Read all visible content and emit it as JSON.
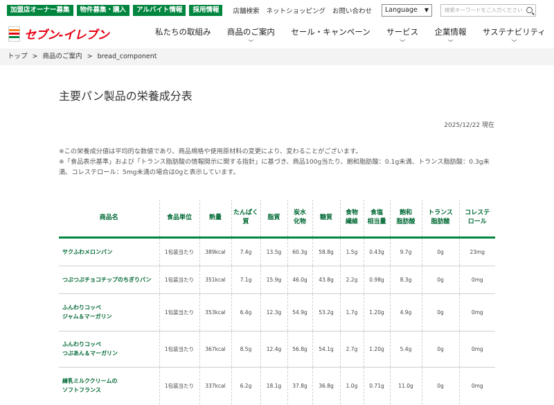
{
  "util": {
    "buttons": [
      "加盟店オーナー募集",
      "物件募集・購入",
      "アルバイト情報",
      "採用情報"
    ],
    "links": [
      "店舗検索",
      "ネットショッピング",
      "お問い合わせ"
    ],
    "language": "Language",
    "search_placeholder": "検索キーワードをご入力ください"
  },
  "logo": {
    "text": "セブン-イレブン",
    "mark": "7"
  },
  "nav": [
    {
      "label": "私たちの取組み",
      "has_sub": false
    },
    {
      "label": "商品のご案内",
      "has_sub": true
    },
    {
      "label": "セール・キャンペーン",
      "has_sub": false
    },
    {
      "label": "サービス",
      "has_sub": true
    },
    {
      "label": "企業情報",
      "has_sub": true
    },
    {
      "label": "サステナビリティ",
      "has_sub": true
    }
  ],
  "breadcrumb": [
    "トップ",
    ">",
    "商品のご案内",
    ">",
    "bread_component"
  ],
  "page": {
    "title": "主要パン製品の栄養成分表",
    "date": "2025/12/22 現在",
    "note1": "※この栄養成分値は平均的な数値であり、商品規格や使用原材料の変更により、変わることがございます。",
    "note2": "※「食品表示基準」および「トランス脂肪酸の情報開示に関する指針」に基づき、商品100g当たり、飽和脂肪酸：0.1g未満、トランス脂肪酸：0.3g未満、コレステロール：5mg未満の場合は0gと表示しています。"
  },
  "table": {
    "headers": [
      "商品名",
      "食品単位",
      "熱量",
      "たんぱく\n質",
      "脂質",
      "炭水\n化物",
      "糖質",
      "食物\n繊維",
      "食塩\n相当量",
      "飽和\n脂肪酸",
      "トランス\n脂肪酸",
      "コレステ\nロール"
    ],
    "rows": [
      [
        "サクふわメロンパン",
        "1包装当たり",
        "389kcal",
        "7.4g",
        "13.5g",
        "60.3g",
        "58.8g",
        "1.5g",
        "0.43g",
        "9.7g",
        "0g",
        "23mg"
      ],
      [
        "つぶつぶチョコチップのちぎりパン",
        "1包装当たり",
        "351kcal",
        "7.1g",
        "15.9g",
        "46.0g",
        "43.8g",
        "2.2g",
        "0.98g",
        "8.3g",
        "0g",
        "0mg"
      ],
      [
        "ふんわりコッペ\nジャム＆マーガリン",
        "1包装当たり",
        "353kcal",
        "6.4g",
        "12.3g",
        "54.9g",
        "53.2g",
        "1.7g",
        "1.20g",
        "4.9g",
        "0g",
        "0mg"
      ],
      [
        "ふんわりコッペ\nつぶあん＆マーガリン",
        "1包装当たり",
        "367kcal",
        "8.5g",
        "12.4g",
        "56.8g",
        "54.1g",
        "2.7g",
        "1.20g",
        "5.4g",
        "0g",
        "0mg"
      ],
      [
        "練乳ミルククリームの\nソフトフランス",
        "1包装当たり",
        "337kcal",
        "6.2g",
        "18.1g",
        "37.8g",
        "36.8g",
        "1.0g",
        "0.71g",
        "11.0g",
        "0g",
        "0mg"
      ]
    ]
  }
}
